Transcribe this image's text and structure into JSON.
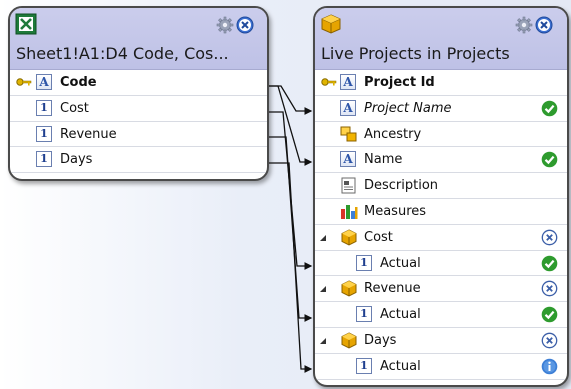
{
  "colors": {
    "panel_header": "#c4c7e9",
    "panel_border": "#4a4a4a",
    "ok_green": "#2e9b2e",
    "info_blue": "#3d7fd6",
    "connector": "#111111"
  },
  "left_panel": {
    "title": "Sheet1!A1:D4 Code, Cos...",
    "icon": "excel-icon",
    "rows": [
      {
        "label": "Code",
        "icon": "text-field-icon",
        "key": true
      },
      {
        "label": "Cost",
        "icon": "number-field-icon",
        "glyph": "1"
      },
      {
        "label": "Revenue",
        "icon": "number-field-icon",
        "glyph": "1"
      },
      {
        "label": "Days",
        "icon": "number-field-icon",
        "glyph": "1"
      }
    ]
  },
  "right_panel": {
    "title": "Live Projects in Projects",
    "icon": "cube-icon",
    "rows": [
      {
        "label": "Project Id",
        "icon": "text-field-icon",
        "key": true
      },
      {
        "label": "Project Name",
        "icon": "text-field-icon",
        "status": "ok"
      },
      {
        "label": "Ancestry",
        "icon": "hierarchy-icon"
      },
      {
        "label": "Name",
        "icon": "text-field-icon",
        "status": "ok"
      },
      {
        "label": "Description",
        "icon": "description-icon"
      },
      {
        "label": "Measures",
        "icon": "measures-icon"
      },
      {
        "label": "Cost",
        "icon": "cube-icon",
        "status": "remove"
      },
      {
        "label": "Actual",
        "icon": "number-field-icon",
        "glyph": "1",
        "status": "ok"
      },
      {
        "label": "Revenue",
        "icon": "cube-icon",
        "status": "remove"
      },
      {
        "label": "Actual",
        "icon": "number-field-icon",
        "glyph": "1",
        "status": "ok"
      },
      {
        "label": "Days",
        "icon": "cube-icon",
        "status": "remove"
      },
      {
        "label": "Actual",
        "icon": "number-field-icon",
        "glyph": "1",
        "status": "info"
      }
    ]
  }
}
